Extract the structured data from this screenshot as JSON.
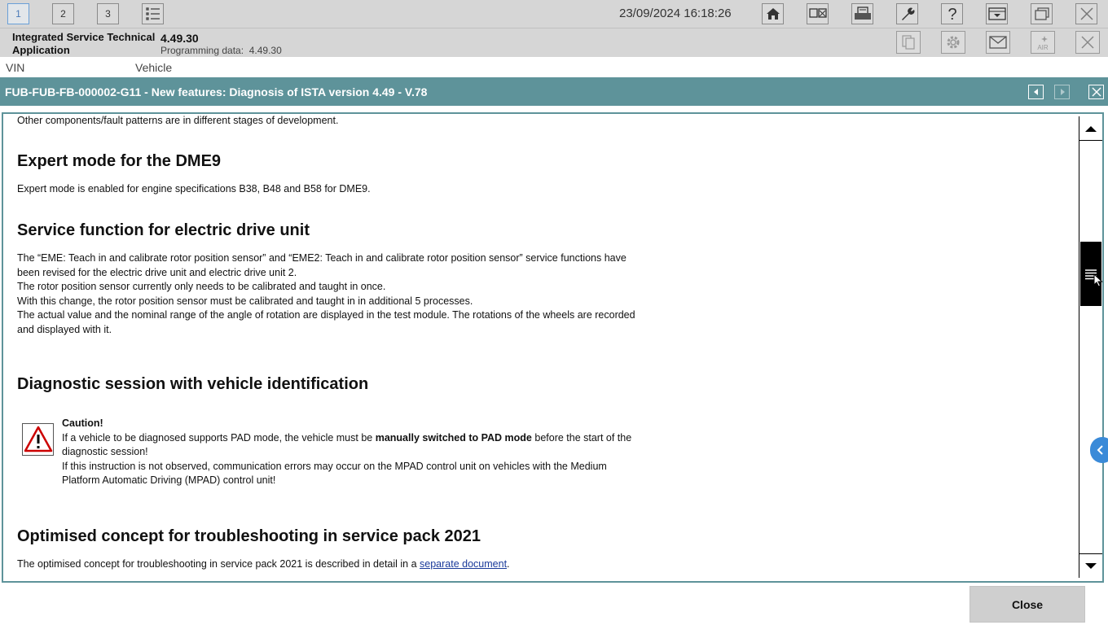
{
  "toolbar": {
    "tabs": [
      "1",
      "2",
      "3"
    ],
    "datetime": "23/09/2024 16:18:26",
    "icons": [
      "list-icon",
      "home-icon",
      "display-settings-icon",
      "printer-icon",
      "wrench-icon",
      "help-icon",
      "dropdown-panel-icon",
      "window-icon",
      "close-icon"
    ]
  },
  "infobar": {
    "app_name": "Integrated Service Technical Application",
    "version": "4.49.30",
    "programming_label": "Programming data:",
    "programming_value": "4.49.30"
  },
  "vinrow": {
    "vin_label": "VIN",
    "vehicle_label": "Vehicle"
  },
  "document": {
    "title": "FUB-FUB-FB-000002-G11 - New features: Diagnosis of ISTA version 4.49 - V.78",
    "intro_line": "Other components/fault patterns are in different stages of development.",
    "sections": [
      {
        "heading": "Expert mode for the DME9",
        "paragraphs": [
          "Expert mode is enabled for engine specifications B38, B48 and B58 for DME9."
        ]
      },
      {
        "heading": "Service function for electric drive unit",
        "paragraphs": [
          "The “EME: Teach in and calibrate rotor position sensor” and “EME2: Teach in and calibrate rotor position sensor” service functions have been revised for the electric drive unit and electric drive unit 2.",
          "The rotor position sensor currently only needs to be calibrated and taught in once.",
          "With this change, the rotor position sensor must be calibrated and taught in in additional 5 processes.",
          "The actual value and the nominal range of the angle of rotation are displayed in the test module. The rotations of the wheels are recorded and displayed with it."
        ]
      },
      {
        "heading": "Diagnostic session with vehicle identification",
        "caution": {
          "title": "Caution!",
          "line1_pre": "If a vehicle to be diagnosed supports PAD mode, the vehicle must be ",
          "line1_bold": "manually switched to PAD mode",
          "line1_post": " before the start of the diagnostic session!",
          "line2": "If this instruction is not observed, communication errors may occur on the MPAD control unit on vehicles with the Medium Platform Automatic Driving (MPAD) control unit!"
        }
      },
      {
        "heading": "Optimised concept for troubleshooting in service pack 2021",
        "text_pre": "The optimised concept for troubleshooting in service pack 2021 is described in detail in a ",
        "link_text": "separate document",
        "text_post": "."
      }
    ]
  },
  "footer": {
    "close_label": "Close"
  },
  "colors": {
    "header_teal": "#5e939a",
    "toolbar_gray": "#d6d6d6",
    "link_blue": "#1a3a9a",
    "accent_blue": "#3a8ad8"
  }
}
